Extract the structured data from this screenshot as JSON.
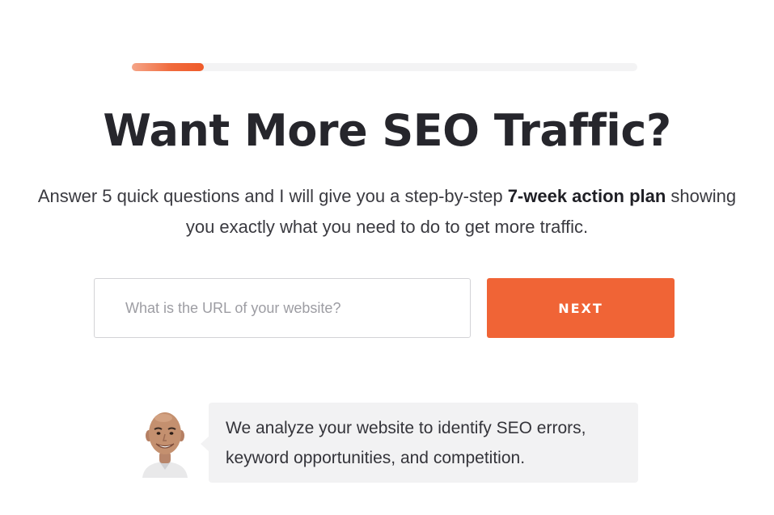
{
  "progress": {
    "fraction": 0.143
  },
  "headline": "Want More SEO Traffic?",
  "subhead": {
    "text_before": "Answer 5 quick questions and I will give you a step-by-step ",
    "emphasis": "7-week action plan",
    "text_after": " showing you exactly what you need to do to get more traffic."
  },
  "form": {
    "url_placeholder": "What is the URL of your website?",
    "url_value": "",
    "next_label": "NEXT"
  },
  "testimonial": {
    "avatar_icon": "person-portrait-icon",
    "message": "We analyze your website to identify SEO errors, keyword opportunities, and competition."
  },
  "colors": {
    "accent": "#f06436",
    "progress_start": "#f5a588",
    "progress_track": "#f3f3f4",
    "bubble_bg": "#f2f2f3"
  }
}
